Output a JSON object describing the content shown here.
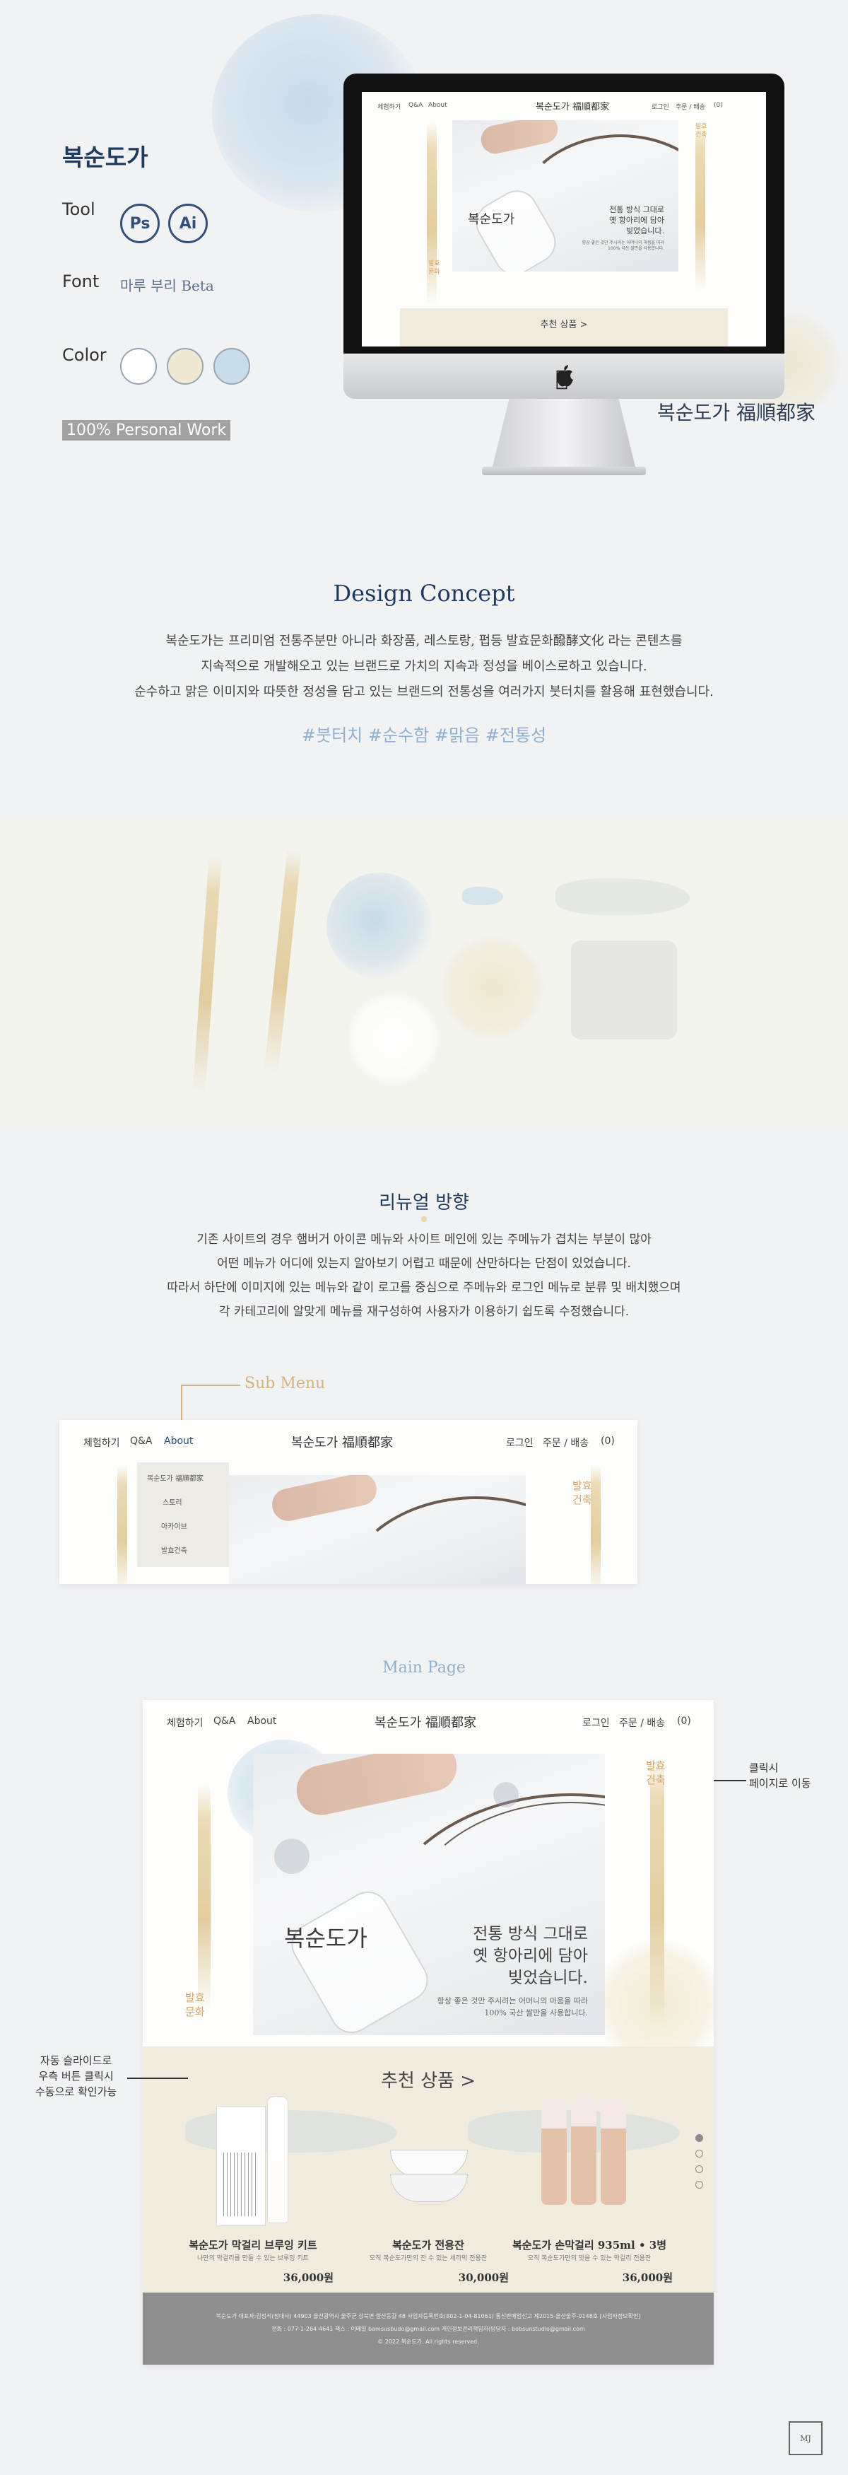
{
  "header": {
    "project_title": "복순도가",
    "tool_label": "Tool",
    "tools": [
      "Ps",
      "Ai"
    ],
    "font_label": "Font",
    "font_name": "마루 부리 Beta",
    "color_label": "Color",
    "colors": [
      "#ffffff",
      "#efe9d3",
      "#c9dcea"
    ],
    "personal_work": "100% Personal Work",
    "brand_signature": "복순도가 福順都家"
  },
  "imac_screen": {
    "nav": [
      "체험하기",
      "Q&A",
      "About"
    ],
    "brand": "복순도가 福順都家",
    "right_nav": [
      "로그인",
      "주문 / 배송",
      "(0)"
    ],
    "hero_name": "복순도가",
    "hero_copy": "전통 방식 그대로\n옛 항아리에 담아\n빚었습니다.",
    "hero_small": "향상 좋은 것만 주시려는 어머니의 마음을 따라\n100% 국산 쌀만을 사용합니다.",
    "vert_left": "발효\n문화",
    "vert_right": "발효\n건축",
    "rec_button": "추천 상품 >"
  },
  "concept": {
    "title": "Design Concept",
    "lines": [
      "복순도가는 프리미엄 전통주분만 아니라 화장품, 레스토랑, 펍등 발효문화醱酵文化 라는 콘텐츠를",
      "지속적으로 개발해오고 있는 브랜드로 가치의 지속과 정성을 베이스로하고 있습니다.",
      "순수하고 맑은 이미지와 따뜻한 정성을 담고 있는 브랜드의 전통성을 여러가지 붓터치를 활용해 표현했습니다."
    ],
    "hashtags": "#붓터치 #순수함 #맑음 #전통성"
  },
  "renewal": {
    "title": "리뉴얼 방향",
    "lines": [
      "기존 사이트의 경우 햄버거 아이콘 메뉴와 사이트 메인에 있는 주메뉴가 겹치는 부분이 많아",
      "어떤 메뉴가 어디에 있는지 알아보기 어렵고 때문에 산만하다는 단점이 있었습니다.",
      "따라서 하단에 이미지에 있는 메뉴와 같이 로고를 중심으로 주메뉴와 로그인 메뉴로 분류 및 배치했으며",
      "각 카테고리에 알맞게 메뉴를 재구성하여 사용자가 이용하기 쉽도록 수정했습니다."
    ]
  },
  "submenu": {
    "label": "Sub Menu",
    "nav": [
      "체험하기",
      "Q&A",
      "About"
    ],
    "brand": "복순도가 福順都家",
    "right_nav": [
      "로그인",
      "주문 / 배송",
      "(0)"
    ],
    "dropdown": [
      "복순도가 福順都家",
      "스토리",
      "아카이브",
      "발효건축"
    ],
    "vert_right": "발효\n건축"
  },
  "main_page": {
    "label": "Main Page",
    "nav": [
      "체험하기",
      "Q&A",
      "About"
    ],
    "brand": "복순도가 福順都家",
    "right_nav": [
      "로그인",
      "주문 / 배송",
      "(0)"
    ],
    "hero_name": "복순도가",
    "hero_copy": "전통 방식 그대로\n옛 항아리에 담아\n빚었습니다.",
    "hero_small": "항상 좋은 것만 주시려는 어머니의 마음을 따라\n100% 국산 쌀만을 사용합니다.",
    "vert_left": "발효\n문화",
    "vert_right": "발효\n건축",
    "rec_title": "추천 상품 >",
    "products": [
      {
        "name": "복순도가 막걸리 브루잉 키트",
        "desc": "나만의 막걸리를 만들 수 있는 브루잉 키트",
        "price": "36,000원"
      },
      {
        "name": "복순도가 전용잔",
        "desc": "오직 복순도가만의 잔 수 있는 세라믹 전용잔",
        "price": "30,000원"
      },
      {
        "name": "복순도가 손막걸리 935ml • 3병",
        "desc": "오직 복순도가만의 맛을 수 있는 막걸리 전용잔",
        "price": "36,000원"
      }
    ],
    "footer": [
      "복순도가 대표자:김정식(정대사)   44903 울산광역시 울주군 상북면 향산동길 48   사업자등록번호(802-1-04-81061)   통신판매업신고 제2015-울산울주-0148호 [사업자정보확인]",
      "전화 : 077-1-264-4641  팩스 : 이메일 bamsusbudo@gmail.com    개인정보관리책임자(담당자 : bobsunstudio@gmail.com",
      "© 2022 복순도가. All rights reserved."
    ]
  },
  "annotations": {
    "click": "클릭시\n페이지로 이동",
    "slide": "자동 슬라이드로\n우측 버튼 클릭시\n수동으로 확인가능"
  },
  "stamp": "MJ"
}
